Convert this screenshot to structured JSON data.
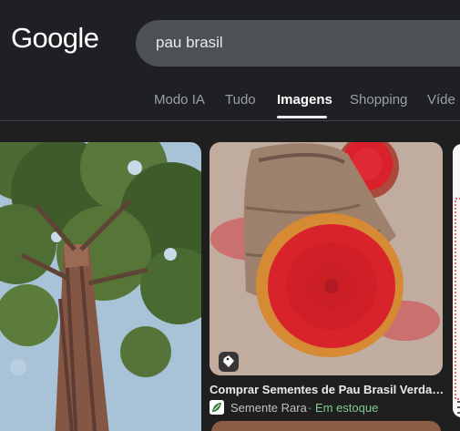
{
  "logo": "Google",
  "search": {
    "query": "pau brasil"
  },
  "tabs": [
    {
      "label": "Modo IA"
    },
    {
      "label": "Tudo"
    },
    {
      "label": "Imagens"
    },
    {
      "label": "Shopping"
    },
    {
      "label": "Víde"
    }
  ],
  "active_tab": "Imagens",
  "results": {
    "main": {
      "title": "Comprar Sementes de Pau Brasil Verdadei...",
      "source": "Semente Rara",
      "separator": "·",
      "availability": "Em estoque",
      "badge_icon": "tag-icon"
    }
  },
  "colors": {
    "background": "#1f1f1f",
    "search_bar": "#4d5156",
    "in_stock": "#81c995",
    "wood_red": "#d8202c"
  }
}
